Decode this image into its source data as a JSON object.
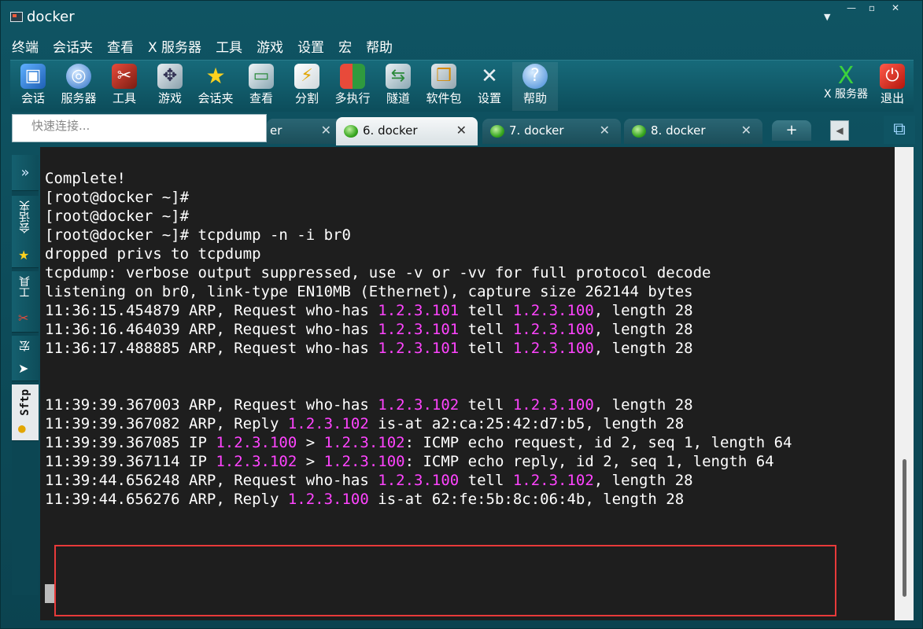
{
  "window": {
    "title": "docker",
    "buttons": [
      "—",
      "▫",
      "✕"
    ]
  },
  "menubar": [
    "终端",
    "会话夹",
    "查看",
    "X 服务器",
    "工具",
    "游戏",
    "设置",
    "宏",
    "帮助"
  ],
  "toolbar": {
    "session": "会话",
    "server": "服务器",
    "tools": "工具",
    "games": "游戏",
    "favorites": "会话夹",
    "view": "查看",
    "split": "分割",
    "multiexec": "多执行",
    "tunnel": "隧道",
    "packages": "软件包",
    "settings": "设置",
    "help": "帮助",
    "xserver": "X 服务器",
    "exit": "退出"
  },
  "quick_connect": {
    "placeholder": "快速连接..."
  },
  "tabs": {
    "partial": "er",
    "tab6": "6. docker",
    "tab7": "7. docker",
    "tab8": "8. docker",
    "close": "✕",
    "add": "+"
  },
  "sidebar": {
    "expand": "»",
    "favorites": "会话夹",
    "tools": "工具",
    "macros": "宏",
    "sftp": "Sftp"
  },
  "terminal": {
    "text_color": "#ffffff",
    "ip_color": "#ff44ff",
    "background": "#1e1e1e",
    "lines": [
      [
        {
          "t": "Complete!"
        }
      ],
      [
        {
          "t": "[root@docker ~]#"
        }
      ],
      [
        {
          "t": "[root@docker ~]#"
        }
      ],
      [
        {
          "t": "[root@docker ~]# tcpdump -n -i br0"
        }
      ],
      [
        {
          "t": "dropped privs to tcpdump"
        }
      ],
      [
        {
          "t": "tcpdump: verbose output suppressed, use -v or -vv for full protocol decode"
        }
      ],
      [
        {
          "t": "listening on br0, link-type EN10MB (Ethernet), capture size 262144 bytes"
        }
      ],
      [
        {
          "t": "11:36:15.454879 ARP, Request who-has "
        },
        {
          "t": "1.2.3.101",
          "ip": true
        },
        {
          "t": " tell "
        },
        {
          "t": "1.2.3.100",
          "ip": true
        },
        {
          "t": ", length 28"
        }
      ],
      [
        {
          "t": "11:36:16.464039 ARP, Request who-has "
        },
        {
          "t": "1.2.3.101",
          "ip": true
        },
        {
          "t": " tell "
        },
        {
          "t": "1.2.3.100",
          "ip": true
        },
        {
          "t": ", length 28"
        }
      ],
      [
        {
          "t": "11:36:17.488885 ARP, Request who-has "
        },
        {
          "t": "1.2.3.101",
          "ip": true
        },
        {
          "t": " tell "
        },
        {
          "t": "1.2.3.100",
          "ip": true
        },
        {
          "t": ", length 28"
        }
      ],
      [
        {
          "t": ""
        }
      ],
      [
        {
          "t": ""
        }
      ],
      [
        {
          "t": "11:39:39.367003 ARP, Request who-has "
        },
        {
          "t": "1.2.3.102",
          "ip": true
        },
        {
          "t": " tell "
        },
        {
          "t": "1.2.3.100",
          "ip": true
        },
        {
          "t": ", length 28"
        }
      ],
      [
        {
          "t": "11:39:39.367082 ARP, Reply "
        },
        {
          "t": "1.2.3.102",
          "ip": true
        },
        {
          "t": " is-at a2:ca:25:42:d7:b5, length 28"
        }
      ],
      [
        {
          "t": "11:39:39.367085 IP "
        },
        {
          "t": "1.2.3.100",
          "ip": true
        },
        {
          "t": " > "
        },
        {
          "t": "1.2.3.102",
          "ip": true
        },
        {
          "t": ": ICMP echo request, id 2, seq 1, length 64"
        }
      ],
      [
        {
          "t": "11:39:39.367114 IP "
        },
        {
          "t": "1.2.3.102",
          "ip": true
        },
        {
          "t": " > "
        },
        {
          "t": "1.2.3.100",
          "ip": true
        },
        {
          "t": ": ICMP echo reply, id 2, seq 1, length 64"
        }
      ],
      [
        {
          "t": "11:39:44.656248 ARP, Request who-has "
        },
        {
          "t": "1.2.3.100",
          "ip": true
        },
        {
          "t": " tell "
        },
        {
          "t": "1.2.3.102",
          "ip": true
        },
        {
          "t": ", length 28"
        }
      ],
      [
        {
          "t": "11:39:44.656276 ARP, Reply "
        },
        {
          "t": "1.2.3.100",
          "ip": true
        },
        {
          "t": " is-at 62:fe:5b:8c:06:4b, length 28"
        }
      ]
    ]
  },
  "annotation": {
    "border_color": "#e83a3a"
  }
}
